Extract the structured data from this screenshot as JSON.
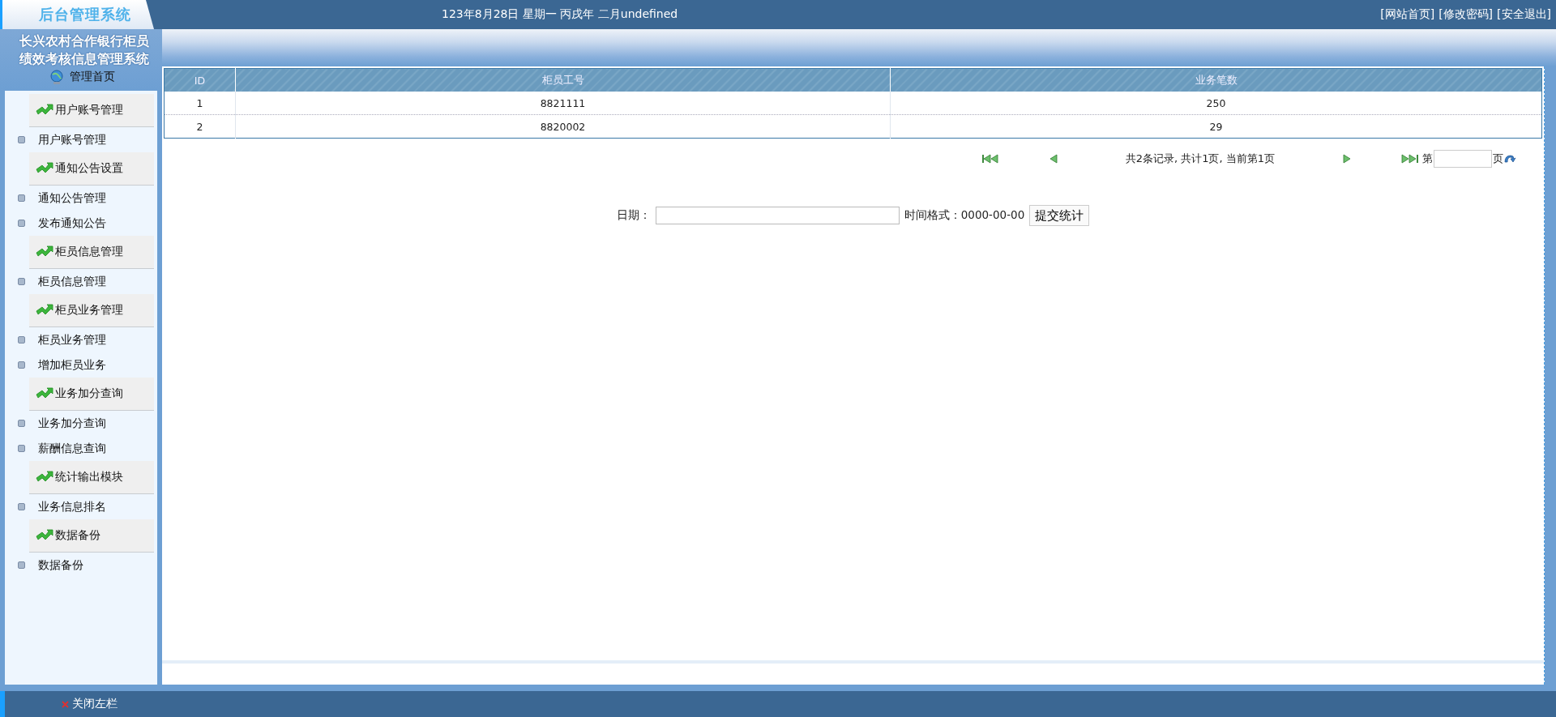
{
  "header": {
    "logo": "后台管理系统",
    "date": "123年8月28日 星期一 丙戌年 二月undefined",
    "links": [
      "[网站首页]",
      "[修改密码]",
      "[安全退出]"
    ]
  },
  "sidebar": {
    "title_lines": [
      "长兴农村合作银行柜员",
      "绩效考核信息管理系统"
    ],
    "home": "管理首页",
    "groups": [
      {
        "title": "用户账号管理",
        "items": [
          "用户账号管理"
        ]
      },
      {
        "title": "通知公告设置",
        "items": [
          "通知公告管理",
          "发布通知公告"
        ]
      },
      {
        "title": "柜员信息管理",
        "items": [
          "柜员信息管理"
        ]
      },
      {
        "title": "柜员业务管理",
        "items": [
          "柜员业务管理",
          "增加柜员业务"
        ]
      },
      {
        "title": "业务加分查询",
        "items": [
          "业务加分查询",
          "薪酬信息查询"
        ]
      },
      {
        "title": "统计输出模块",
        "items": [
          "业务信息排名"
        ]
      },
      {
        "title": "数据备份",
        "items": [
          "数据备份"
        ]
      }
    ]
  },
  "table": {
    "columns": [
      "ID",
      "柜员工号",
      "业务笔数"
    ],
    "rows": [
      [
        "1",
        "8821111",
        "250"
      ],
      [
        "2",
        "8820002",
        "29"
      ]
    ]
  },
  "pager": {
    "summary": "共2条记录, 共计1页, 当前第1页",
    "page_prefix": "第",
    "page_suffix": "页"
  },
  "date_form": {
    "label": "日期：",
    "hint": "时间格式：0000-00-00",
    "button": "提交统计"
  },
  "footer": {
    "close_sidebar": "关闭左栏"
  }
}
